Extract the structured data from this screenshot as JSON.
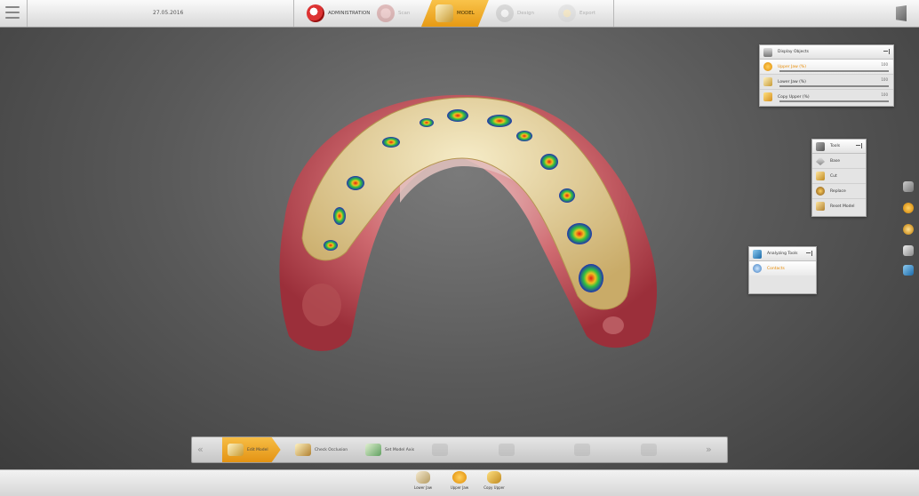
{
  "topbar": {
    "date": "27.05.2016",
    "tabs": [
      {
        "label": "ADMINISTRATION",
        "icon": "teeth-icon",
        "state": "normal"
      },
      {
        "label": "Scan",
        "icon": "scan-icon",
        "state": "dim"
      },
      {
        "label": "MODEL",
        "icon": "model-icon",
        "state": "active"
      },
      {
        "label": "Design",
        "icon": "design-icon",
        "state": "dim"
      },
      {
        "label": "Export",
        "icon": "export-icon",
        "state": "dim"
      }
    ]
  },
  "display_objects": {
    "title": "Display Objects",
    "rows": [
      {
        "label": "Upper Jaw (%)",
        "value": "100",
        "level": 1.0,
        "active": true
      },
      {
        "label": "Lower Jaw (%)",
        "value": "100",
        "level": 1.0,
        "active": false
      },
      {
        "label": "Copy Upper (%)",
        "value": "100",
        "level": 1.0,
        "active": false
      }
    ]
  },
  "tools": {
    "title": "Tools",
    "rows": [
      "Base",
      "Cut",
      "Replace",
      "Reset Model"
    ]
  },
  "analyzing_tools": {
    "title": "Analyzing Tools",
    "rows": [
      "Contacts"
    ]
  },
  "bottom_steps": [
    {
      "label": "Edit Model",
      "state": "active"
    },
    {
      "label": "Check Occlusion",
      "state": "normal"
    },
    {
      "label": "Set Model Axis",
      "state": "normal"
    },
    {
      "label": "",
      "state": "dim"
    },
    {
      "label": "",
      "state": "dim"
    },
    {
      "label": "",
      "state": "dim"
    },
    {
      "label": "",
      "state": "dim"
    }
  ],
  "jaws": [
    {
      "label": "Lower Jaw",
      "active": false
    },
    {
      "label": "Upper Jaw",
      "active": true
    },
    {
      "label": "Copy Upper",
      "active": false
    }
  ],
  "colors": {
    "accent": "#f0a020",
    "gum": "#c9505a",
    "tooth": "#e8d6a2",
    "contact_blue": "#1a2fa0"
  }
}
